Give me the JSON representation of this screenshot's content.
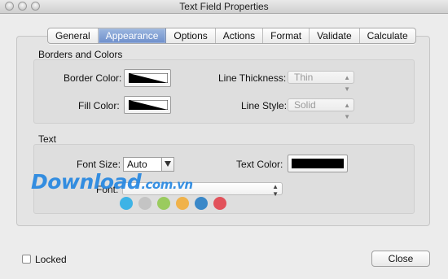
{
  "window": {
    "title": "Text Field Properties"
  },
  "tabs": [
    {
      "label": "General"
    },
    {
      "label": "Appearance"
    },
    {
      "label": "Options"
    },
    {
      "label": "Actions"
    },
    {
      "label": "Format"
    },
    {
      "label": "Validate"
    },
    {
      "label": "Calculate"
    }
  ],
  "borders": {
    "section_title": "Borders and Colors",
    "border_color_label": "Border Color:",
    "fill_color_label": "Fill Color:",
    "line_thickness_label": "Line Thickness:",
    "line_thickness_value": "Thin",
    "line_style_label": "Line Style:",
    "line_style_value": "Solid"
  },
  "text": {
    "section_title": "Text",
    "font_size_label": "Font Size:",
    "font_size_value": "Auto",
    "text_color_label": "Text Color:",
    "text_color_value": "#000000",
    "font_label": "Font:",
    "font_value": ""
  },
  "watermark": {
    "brand": "Download",
    "suffix": ".com.vn",
    "dot_colors": [
      "#3db3e6",
      "#c4c4c4",
      "#9acb5e",
      "#f0b24a",
      "#3a88c8",
      "#e2525b"
    ]
  },
  "footer": {
    "locked_label": "Locked",
    "close_label": "Close"
  }
}
